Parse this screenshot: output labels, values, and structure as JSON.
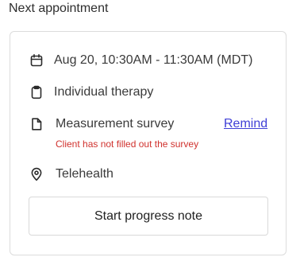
{
  "section": {
    "title": "Next appointment"
  },
  "appointment": {
    "datetime": "Aug 20, 10:30AM - 11:30AM (MDT)",
    "service": "Individual therapy",
    "survey": {
      "label": "Measurement survey",
      "action_label": "Remind",
      "warning": "Client has not filled out the survey"
    },
    "location": "Telehealth"
  },
  "actions": {
    "primary_label": "Start progress note"
  },
  "colors": {
    "link": "#3f3fd6",
    "warning": "#d0312d",
    "border": "#dcdcdc"
  },
  "icons": {
    "datetime": "calendar-icon",
    "service": "clipboard-icon",
    "survey": "document-icon",
    "location": "map-pin-icon"
  }
}
